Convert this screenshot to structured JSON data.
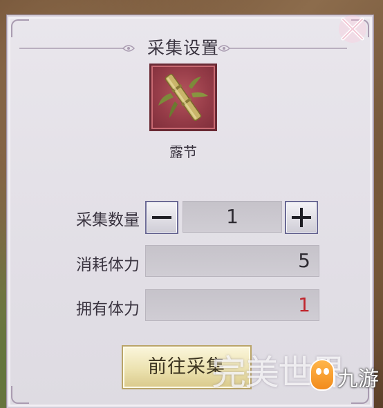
{
  "dialog": {
    "title": "采集设置",
    "item": {
      "name": "露节",
      "icon": "bamboo-icon"
    },
    "quantity": {
      "label": "采集数量",
      "value": "1",
      "minus_icon": "minus-icon",
      "plus_icon": "plus-icon"
    },
    "stamina_cost": {
      "label": "消耗体力",
      "value": "5"
    },
    "stamina_owned": {
      "label": "拥有体力",
      "value": "1",
      "color": "#c0262e"
    },
    "go_button": "前往采集",
    "close_icon": "close-icon"
  },
  "watermark": {
    "text": "完美世界",
    "brand": "九游"
  },
  "colors": {
    "panel": "#e4e1e7",
    "icon_bg": "#963c48",
    "button_gold": "#ece2b0",
    "stepper_border": "#6b6a95"
  }
}
